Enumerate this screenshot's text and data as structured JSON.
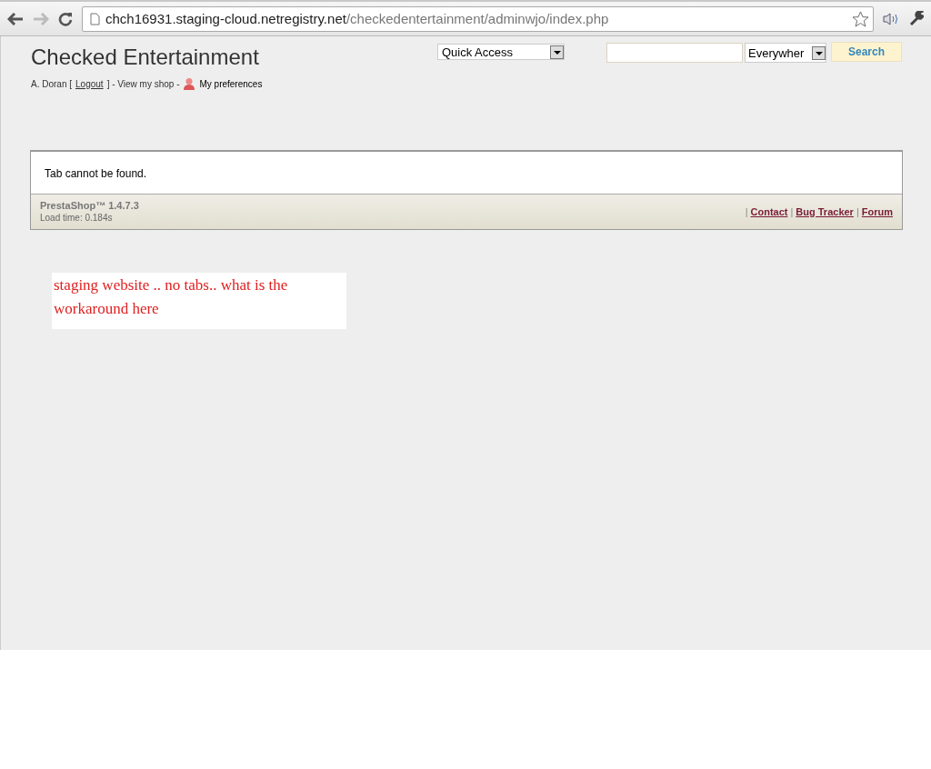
{
  "browser": {
    "url_host": "chch16931.staging-cloud.netregistry.net",
    "url_path": "/checkedentertainment/adminwjo/index.php"
  },
  "header": {
    "title": "Checked Entertainment",
    "user": "A. Doran [",
    "logout": "Logout",
    "after_logout": "] - View my shop -",
    "preferences": "My preferences"
  },
  "quick_access": {
    "value": "Quick Access"
  },
  "search": {
    "scope": "Everywher",
    "button": "Search"
  },
  "message": "Tab cannot be found.",
  "footer": {
    "version": "PrestaShop™ 1.4.7.3",
    "load_time": "Load time: 0.184s",
    "links": [
      "Contact",
      "Bug Tracker",
      "Forum"
    ],
    "separator": "|"
  },
  "annotation": "staging website .. no tabs.. what is the workaround here"
}
